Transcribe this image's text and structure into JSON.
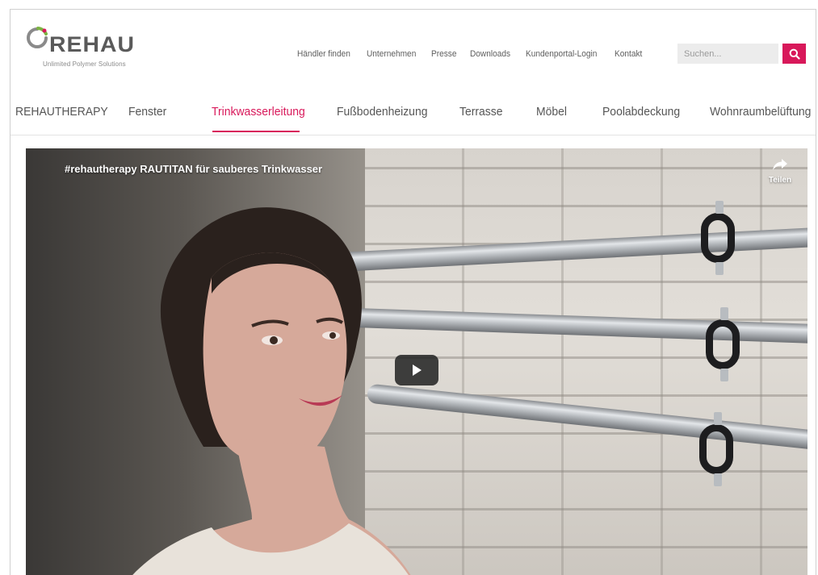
{
  "brand": {
    "name": "REHAU",
    "tagline": "Unlimited Polymer Solutions",
    "accent_color": "#d8185a"
  },
  "topnav": {
    "items": [
      {
        "label": "Händler finden"
      },
      {
        "label": "Unternehmen"
      },
      {
        "label": "Presse"
      },
      {
        "label": "Downloads"
      },
      {
        "label": "Kundenportal-Login"
      },
      {
        "label": "Kontakt"
      }
    ]
  },
  "search": {
    "placeholder": "Suchen...",
    "icon": "search-icon"
  },
  "mainnav": {
    "items": [
      {
        "label": "REHAUTHERAPY"
      },
      {
        "label": "Fenster"
      },
      {
        "label": "Trinkwasserleitung",
        "active": true
      },
      {
        "label": "Fußbodenheizung"
      },
      {
        "label": "Terrasse"
      },
      {
        "label": "Möbel"
      },
      {
        "label": "Poolabdeckung"
      },
      {
        "label": "Wohnraumbelüftung"
      }
    ]
  },
  "video": {
    "title": "#rehautherapy RAUTITAN für sauberes Trinkwasser",
    "share_label": "Teilen",
    "share_icon": "share-arrow-icon",
    "play_icon": "play-icon"
  }
}
